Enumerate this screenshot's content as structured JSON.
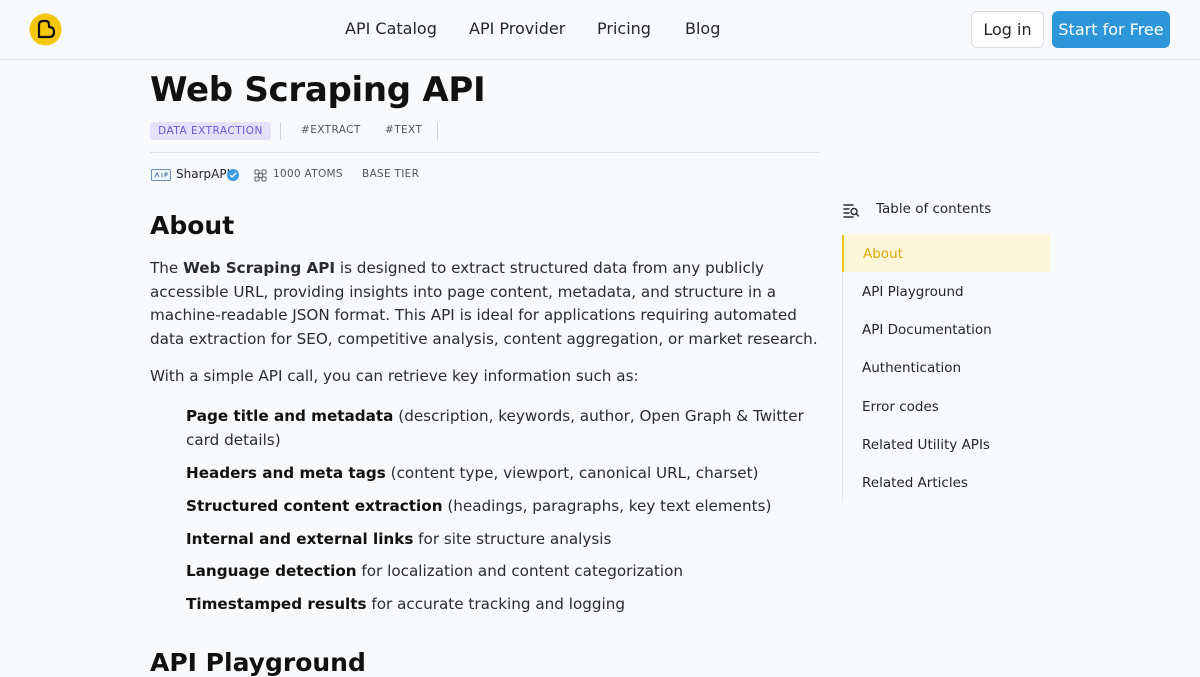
{
  "header": {
    "nav": [
      "API Catalog",
      "API Provider",
      "Pricing",
      "Blog"
    ],
    "login_label": "Log in",
    "start_label": "Start for Free"
  },
  "colors": {
    "accent": "#2c96d8",
    "logo": "#f5c60a",
    "tag_bg": "#e6e1fb",
    "tag_text": "#6b55d6",
    "toc_active_bg": "#fef6d8",
    "toc_active_text": "#e0a800"
  },
  "page": {
    "title": "Web Scraping API",
    "tags": {
      "category": "DATA EXTRACTION",
      "hashtags": [
        "#EXTRACT",
        "#TEXT"
      ]
    },
    "meta": {
      "provider": "SharpAPI",
      "atoms": "1000 ATOMS",
      "tier": "BASE TIER"
    }
  },
  "about": {
    "heading": "About",
    "intro_prefix": "The ",
    "intro_bold": "Web Scraping API",
    "intro_rest": " is designed to extract structured data from any publicly accessible URL, providing insights into page content, metadata, and structure in a machine-readable JSON format. This API is ideal for applications requiring automated data extraction for SEO, competitive analysis, content aggregation, or market research.",
    "lead": "With a simple API call, you can retrieve key information such as:",
    "features": [
      {
        "bold": "Page title and metadata",
        "rest": " (description, keywords, author, Open Graph & Twitter card details)"
      },
      {
        "bold": "Headers and meta tags",
        "rest": " (content type, viewport, canonical URL, charset)"
      },
      {
        "bold": "Structured content extraction",
        "rest": " (headings, paragraphs, key text elements)"
      },
      {
        "bold": "Internal and external links",
        "rest": " for site structure analysis"
      },
      {
        "bold": "Language detection",
        "rest": " for localization and content categorization"
      },
      {
        "bold": "Timestamped results",
        "rest": " for accurate tracking and logging"
      }
    ]
  },
  "playground": {
    "heading": "API Playground"
  },
  "toc": {
    "title": "Table of contents",
    "items": [
      "About",
      "API Playground",
      "API Documentation",
      "Authentication",
      "Error codes",
      "Related Utility APIs",
      "Related Articles"
    ]
  }
}
